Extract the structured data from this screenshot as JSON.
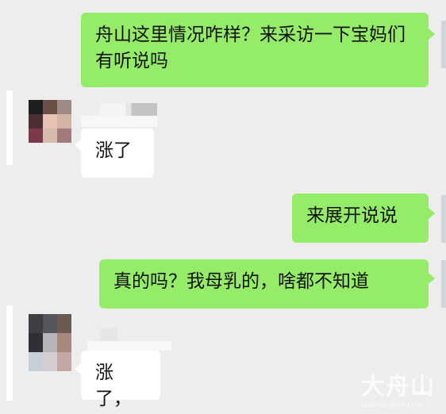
{
  "messages": [
    {
      "side": "out",
      "text": "舟山这里情况咋样？来采访一下宝妈们有听说吗"
    },
    {
      "side": "in",
      "text": "涨了"
    },
    {
      "side": "out",
      "text": "来展开说说"
    },
    {
      "side": "out",
      "text": "真的吗？我母乳的，啥都不知道"
    },
    {
      "side": "in",
      "text": "涨了，"
    }
  ],
  "watermark": {
    "logo": "大舟山",
    "sub": "Dazhoushan.com"
  },
  "colors": {
    "outgoing": "#95ec69",
    "incoming": "#ffffff",
    "background": "#ededed"
  }
}
